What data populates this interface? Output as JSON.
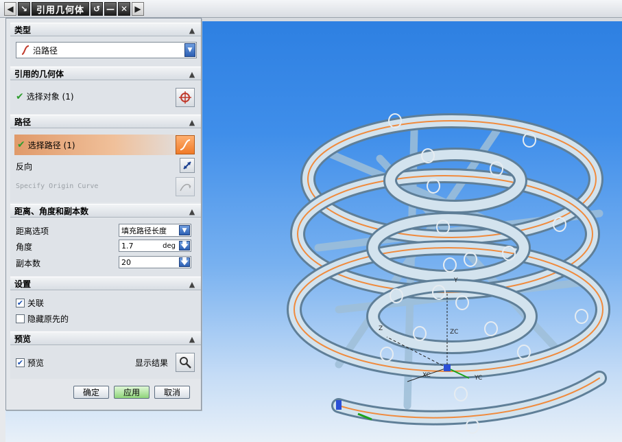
{
  "window": {
    "title": "引用几何体"
  },
  "sections": {
    "type": {
      "title": "类型",
      "selected": "沿路径"
    },
    "ref_geometry": {
      "title": "引用的几何体",
      "select_object": "选择对象 (1)"
    },
    "path": {
      "title": "路径",
      "select_path": "选择路径 (1)",
      "reverse": "反向",
      "specify_origin": "Specify Origin Curve"
    },
    "distance": {
      "title": "距离、角度和副本数",
      "distance_option_label": "距离选项",
      "distance_option_value": "填充路径长度",
      "angle_label": "角度",
      "angle_value": "1.7",
      "angle_unit": "deg",
      "copies_label": "副本数",
      "copies_value": "20"
    },
    "settings": {
      "title": "设置",
      "associative": "关联",
      "associative_checked": true,
      "hide_original": "隐藏原先的",
      "hide_original_checked": false
    },
    "preview": {
      "title": "预览",
      "preview_label": "预览",
      "preview_checked": true,
      "show_result": "显示结果"
    }
  },
  "buttons": {
    "ok": "确定",
    "apply": "应用",
    "cancel": "取消"
  },
  "viewport": {
    "axis_labels": {
      "y": "Y",
      "zc": "ZC",
      "z": "Z",
      "xc": "XC",
      "yc": "YC"
    }
  },
  "colors": {
    "accent_orange": "#f08a3c",
    "coil": "#c9dbe8",
    "background_top": "#2a7de0"
  }
}
